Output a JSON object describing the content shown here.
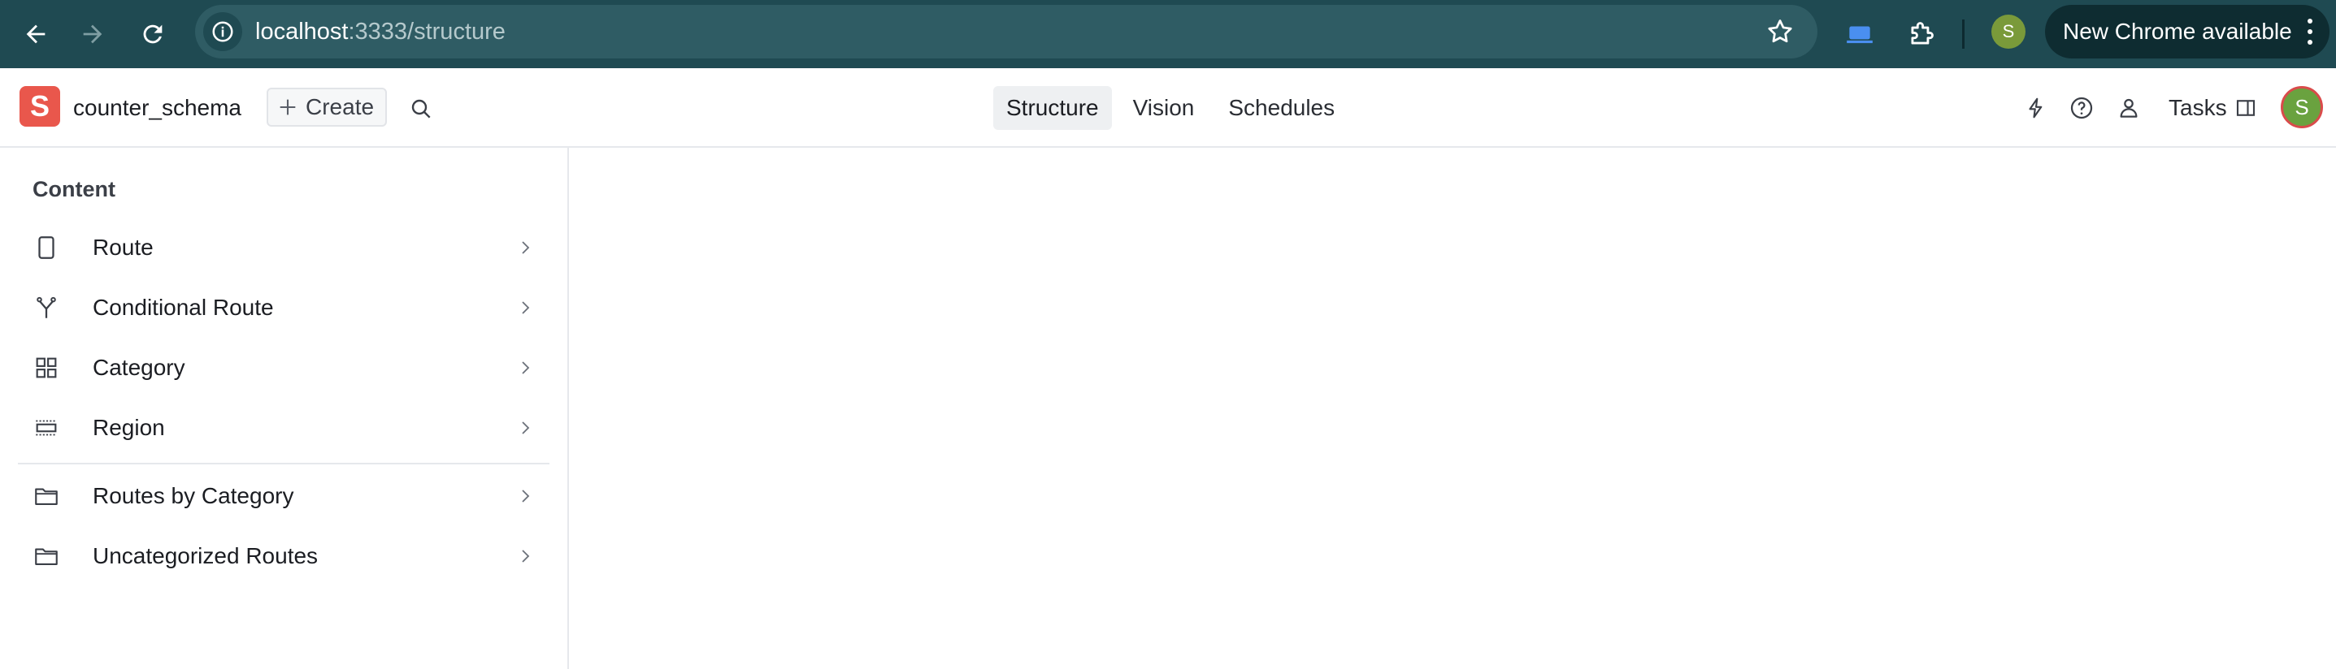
{
  "browser": {
    "url_host": "localhost",
    "url_path": ":3333/structure",
    "profile_initial": "S",
    "update_label": "New Chrome available"
  },
  "app": {
    "logo_letter": "S",
    "project_name": "counter_schema",
    "create_label": "Create",
    "tabs": [
      {
        "label": "Structure",
        "active": true
      },
      {
        "label": "Vision",
        "active": false
      },
      {
        "label": "Schedules",
        "active": false
      }
    ],
    "tasks_label": "Tasks",
    "user_initial": "S"
  },
  "sidebar": {
    "title": "Content",
    "items": [
      {
        "label": "Route",
        "icon": "document-icon"
      },
      {
        "label": "Conditional Route",
        "icon": "fork-icon"
      },
      {
        "label": "Category",
        "icon": "grid-icon"
      },
      {
        "label": "Region",
        "icon": "region-icon"
      },
      {
        "label": "Routes by Category",
        "icon": "folder-icon"
      },
      {
        "label": "Uncategorized Routes",
        "icon": "folder-icon"
      }
    ]
  },
  "colors": {
    "chrome_bg": "#1f4a52",
    "logo_bg": "#e9574c",
    "avatar_bg": "#6aa23f"
  }
}
